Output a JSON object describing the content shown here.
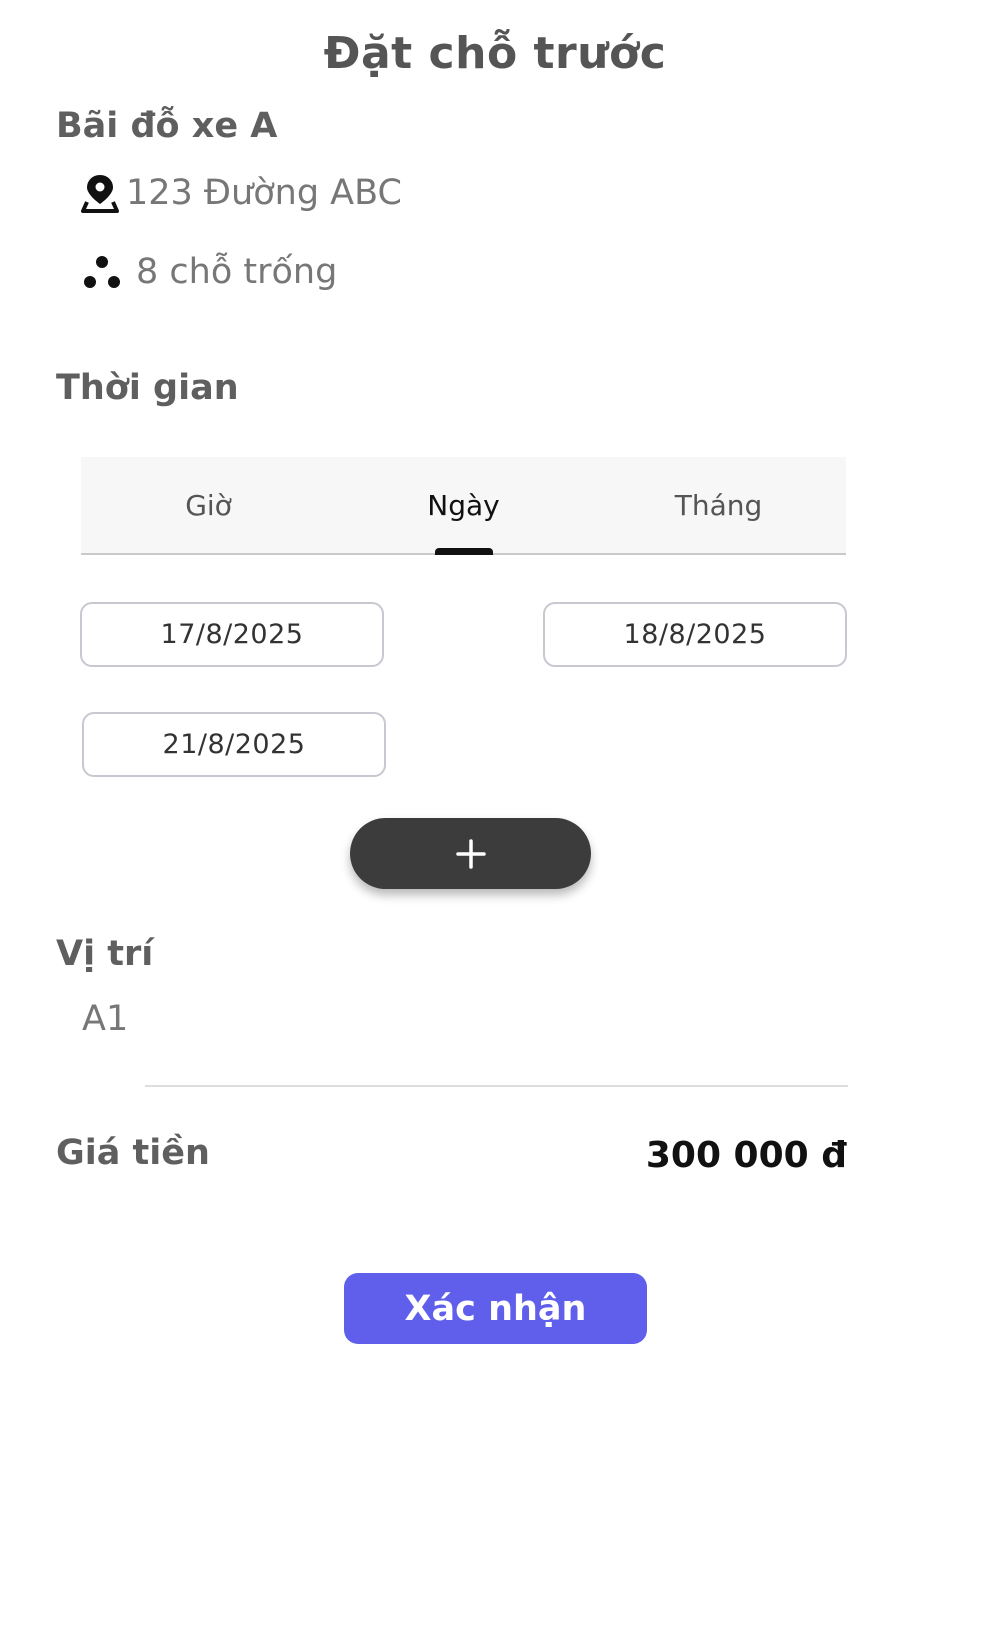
{
  "header": {
    "title": "Đặt chỗ trước"
  },
  "lot": {
    "name": "Bãi đỗ xe A",
    "address": "123 Đường ABC",
    "address_icon": "map-pin-icon",
    "available_slots": "8 chỗ trống",
    "slots_icon": "dots-cluster-icon"
  },
  "time_section": {
    "label": "Thời gian",
    "tabs": [
      {
        "label": "Giờ",
        "active": false
      },
      {
        "label": "Ngày",
        "active": true
      },
      {
        "label": "Tháng",
        "active": false
      }
    ],
    "dates": [
      "17/8/2025",
      "18/8/2025",
      "21/8/2025"
    ],
    "add_icon": "plus-icon"
  },
  "position_section": {
    "label": "Vị trí",
    "value": "A1"
  },
  "price_section": {
    "label": "Giá tiền",
    "value": "300 000 đ"
  },
  "actions": {
    "confirm_label": "Xác nhận"
  },
  "colors": {
    "accent": "#5f5fec",
    "add_button": "#3c3c3c",
    "tab_background": "#f7f7f7"
  }
}
